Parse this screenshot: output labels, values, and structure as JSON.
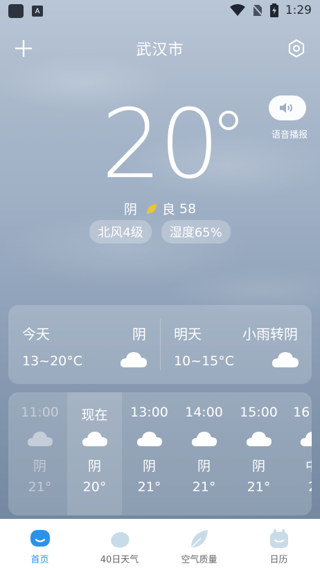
{
  "status_bar": {
    "time": "1:29",
    "left_icons": [
      "app-square-icon",
      "a-badge-icon"
    ],
    "right_icons": [
      "wifi-icon",
      "no-sim-icon",
      "battery-charging-icon"
    ],
    "a_badge": "A"
  },
  "header": {
    "city": "武汉市",
    "add_icon": "plus-icon",
    "settings_icon": "settings-hex-icon"
  },
  "voice": {
    "label": "语音播报",
    "icon": "speaker-icon"
  },
  "current": {
    "temperature": "20",
    "condition": "阴",
    "aqi_label": "良",
    "aqi_value": "58",
    "wind": "北风4级",
    "humidity": "湿度65%"
  },
  "daily": [
    {
      "name": "今天",
      "condition": "阴",
      "range": "13~20°C",
      "icon": "cloud-icon"
    },
    {
      "name": "明天",
      "condition": "小雨转阴",
      "range": "10~15°C",
      "icon": "cloud-icon"
    }
  ],
  "hourly": [
    {
      "time": "11:00",
      "condition": "阴",
      "temp": "21°",
      "state": "past"
    },
    {
      "time": "现在",
      "condition": "阴",
      "temp": "20°",
      "state": "now"
    },
    {
      "time": "13:00",
      "condition": "阴",
      "temp": "21°",
      "state": "future"
    },
    {
      "time": "14:00",
      "condition": "阴",
      "temp": "21°",
      "state": "future"
    },
    {
      "time": "15:00",
      "condition": "阴",
      "temp": "21°",
      "state": "future"
    },
    {
      "time": "16",
      "condition": "中",
      "temp": "2",
      "state": "future"
    }
  ],
  "nav": [
    {
      "label": "首页",
      "icon": "home-bubble-icon",
      "active": true
    },
    {
      "label": "40日天气",
      "icon": "forecast-40-icon",
      "active": false
    },
    {
      "label": "空气质量",
      "icon": "leaf-icon",
      "active": false
    },
    {
      "label": "日历",
      "icon": "calendar-icon",
      "active": false
    }
  ],
  "colors": {
    "accent": "#2a93e8",
    "leaf": "#f0c420",
    "nav_inactive_icon": "#c8dbe8"
  }
}
